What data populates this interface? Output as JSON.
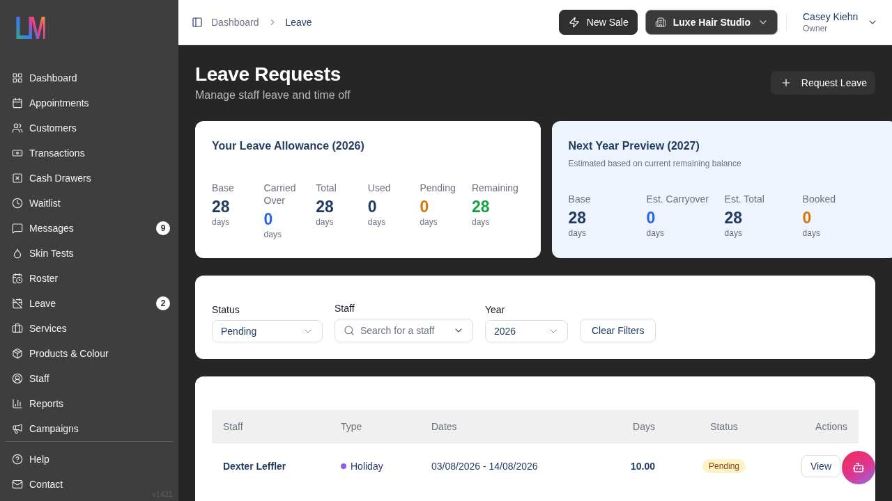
{
  "sidebar": {
    "logo": "LM",
    "items": [
      {
        "label": "Dashboard"
      },
      {
        "label": "Appointments"
      },
      {
        "label": "Customers"
      },
      {
        "label": "Transactions"
      },
      {
        "label": "Cash Drawers"
      },
      {
        "label": "Waitlist"
      },
      {
        "label": "Messages",
        "badge": "9"
      },
      {
        "label": "Skin Tests"
      },
      {
        "label": "Roster"
      },
      {
        "label": "Leave",
        "badge": "2"
      },
      {
        "label": "Services"
      },
      {
        "label": "Products & Colour"
      },
      {
        "label": "Staff"
      },
      {
        "label": "Reports"
      },
      {
        "label": "Campaigns"
      }
    ],
    "footer_items": [
      {
        "label": "Help"
      },
      {
        "label": "Contact"
      }
    ],
    "version": "v1421"
  },
  "header": {
    "breadcrumb": [
      {
        "label": "Dashboard",
        "current": false
      },
      {
        "label": "Leave",
        "current": true
      }
    ],
    "new_sale_button": "New Sale",
    "studio_selector": "Luxe Hair Studio",
    "user": {
      "name": "Casey Kiehn",
      "role": "Owner"
    }
  },
  "page": {
    "title": "Leave Requests",
    "subtitle": "Manage staff leave and time off",
    "request_button": "Request Leave"
  },
  "allowance_card": {
    "title": "Your Leave Allowance (2026)",
    "stats": [
      {
        "label": "Base",
        "value": "28",
        "unit": "days",
        "color": "#1e3a5f"
      },
      {
        "label": "Carried Over",
        "value": "0",
        "unit": "days",
        "color": "#2563eb"
      },
      {
        "label": "Total",
        "value": "28",
        "unit": "days",
        "color": "#1e3a5f"
      },
      {
        "label": "Used",
        "value": "0",
        "unit": "days",
        "color": "#1e3a5f"
      },
      {
        "label": "Pending",
        "value": "0",
        "unit": "days",
        "color": "#d97706"
      },
      {
        "label": "Remaining",
        "value": "28",
        "unit": "days",
        "color": "#16a34a"
      }
    ]
  },
  "preview_card": {
    "title": "Next Year Preview (2027)",
    "subtitle": "Estimated based on current remaining balance",
    "stats": [
      {
        "label": "Base",
        "value": "28",
        "unit": "days",
        "color": "#1e3a5f"
      },
      {
        "label": "Est. Carryover",
        "value": "0",
        "unit": "days",
        "color": "#2563eb"
      },
      {
        "label": "Est. Total",
        "value": "28",
        "unit": "days",
        "color": "#1e3a5f"
      },
      {
        "label": "Booked",
        "value": "0",
        "unit": "days",
        "color": "#d97706"
      }
    ]
  },
  "filters": {
    "fields": [
      {
        "label": "Status",
        "kind": "select",
        "value": "Pending"
      },
      {
        "label": "Staff",
        "kind": "search",
        "placeholder": "Search for a staff"
      },
      {
        "label": "Year",
        "kind": "select",
        "value": "2026"
      }
    ],
    "clear_button": "Clear Filters"
  },
  "table": {
    "columns": [
      "Staff",
      "Type",
      "Dates",
      "Days",
      "Status",
      "Actions"
    ],
    "rows": [
      {
        "staff": "Dexter Leffler",
        "type": {
          "label": "Holiday",
          "color": "#8b5cf6"
        },
        "dates": "03/08/2026 - 14/08/2026",
        "days": "10.00",
        "status": {
          "label": "Pending",
          "kind": "pending"
        },
        "action": "View"
      }
    ]
  }
}
